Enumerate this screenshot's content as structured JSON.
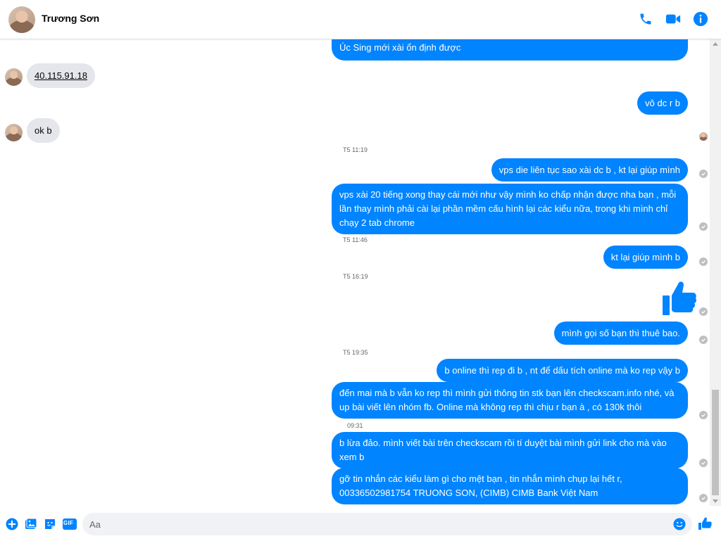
{
  "contact": {
    "name": "Trương Sơn"
  },
  "header": {
    "icons": [
      "phone-icon",
      "video-icon",
      "info-icon"
    ]
  },
  "colors": {
    "accent": "#0084ff",
    "incoming_bubble": "#e4e6eb",
    "seen": "#bcc0c4"
  },
  "messages": {
    "top_partial": "Úc Sing mới xài ổn định được",
    "in_ip": "40.115.91.18",
    "out_vo": "vô dc r b",
    "in_ok": "ok b",
    "ts1": "T5 11:19",
    "out_vps_die": "vps die liên tục sao xài dc b , kt lại giúp mình",
    "out_long1": [
      "vps xài 20 tiếng xong thay cái mới như vậy mình ko chấp nhận được nha bạn , mỗi",
      "lần thay mình phải cài lại phần mềm cấu hình lại các kiểu nữa, trong khi mình chỉ",
      "chạy 2 tab chrome"
    ],
    "ts2": "T5 11:46",
    "out_kt": "kt lại giúp mình b",
    "ts3": "T5 16:19",
    "out_call": "mình gọi số bạn thì thuê bao.",
    "ts4": "T5 19:35",
    "out_online": "b online thì rep đi b , nt để dấu tích online mà ko rep vậy b",
    "out_long2": [
      "đến mai mà b vẫn ko rep thì mình gửi thông tin stk bạn lên checkscam.info nhé, và",
      "up bài viết lên nhóm fb. Online mà không rep thì chịu r bạn à , có 130k thôi"
    ],
    "ts5": "09:31",
    "out_long3": [
      "b lừa đảo. mình viết bài trên checkscam rồi tí duyệt bài mình gửi link cho mà vào",
      "xem b"
    ],
    "out_long4": [
      "gỡ tin nhắn các kiểu làm gì cho mệt bạn , tin nhắn mình chụp lại hết r,",
      "00336502981754 TRUONG SON, (CIMB) CIMB Bank Việt Nam"
    ]
  },
  "composer": {
    "placeholder": "Aa",
    "icons": [
      "add-icon",
      "image-icon",
      "sticker-icon",
      "gif-icon",
      "emoji-icon",
      "like-icon"
    ],
    "gif_label": "GIF"
  }
}
